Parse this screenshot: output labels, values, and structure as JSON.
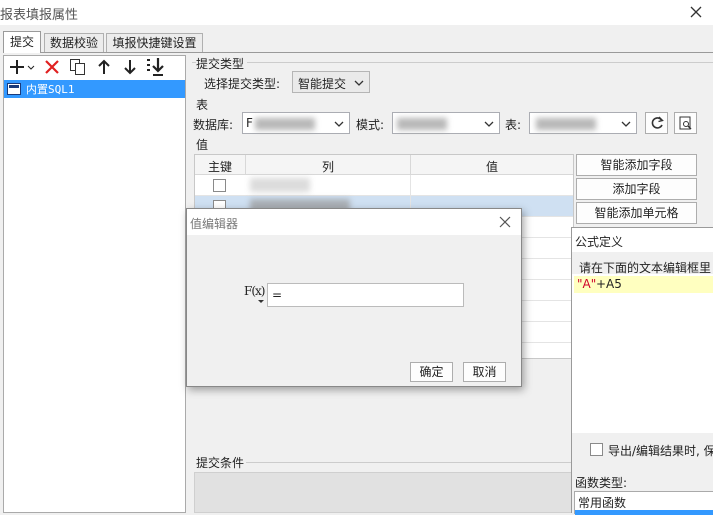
{
  "window": {
    "title": "报表填报属性"
  },
  "tabs": [
    {
      "label": "提交"
    },
    {
      "label": "数据校验"
    },
    {
      "label": "填报快捷键设置"
    }
  ],
  "tree": {
    "items": [
      {
        "label": "内置SQL1"
      }
    ]
  },
  "submit_type": {
    "group": "提交类型",
    "label": "选择提交类型:",
    "value": "智能提交"
  },
  "table_section": {
    "group": "表",
    "db_label": "数据库:",
    "db_value": "F",
    "schema_label": "模式:",
    "table_label": "表:"
  },
  "value_section": {
    "group": "值",
    "columns": [
      "主键",
      "列",
      "值"
    ],
    "buttons": [
      "智能添加字段",
      "添加字段",
      "智能添加单元格"
    ]
  },
  "condition": {
    "label": "提交条件"
  },
  "value_editor": {
    "title": "值编辑器",
    "fx": "F(x)",
    "input_value": "=",
    "ok": "确定",
    "cancel": "取消"
  },
  "formula": {
    "title": "公式定义",
    "hint": "请在下面的文本编辑框里",
    "expr_str": "\"A\"",
    "expr_rest": "+A5",
    "checkbox_label": "导出/编辑结果时, 保",
    "func_type_label": "函数类型:",
    "func_first": "常用函数"
  }
}
